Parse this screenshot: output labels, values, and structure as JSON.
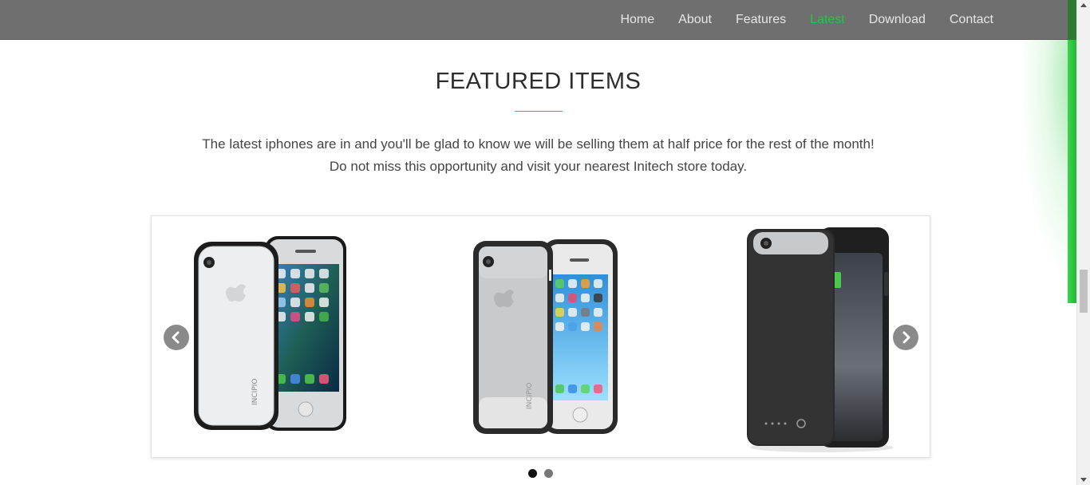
{
  "nav": {
    "items": [
      {
        "label": "Home",
        "active": false
      },
      {
        "label": "About",
        "active": false
      },
      {
        "label": "Features",
        "active": false
      },
      {
        "label": "Latest",
        "active": true
      },
      {
        "label": "Download",
        "active": false
      },
      {
        "label": "Contact",
        "active": false
      }
    ],
    "active_color": "#27c34a",
    "background": "#6f6f6f"
  },
  "section": {
    "title": "FEATURED ITEMS",
    "intro_line1": "The latest iphones are in and you'll be glad to know we will be selling them at half price for the rest of the month!",
    "intro_line2": "Do not miss this opportunity and visit your nearest Initech store today."
  },
  "carousel": {
    "products": [
      {
        "name": "clear-bumper-phone-case"
      },
      {
        "name": "grey-frosted-phone-case"
      },
      {
        "name": "black-battery-phone-case"
      }
    ],
    "prev_icon": "chevron-left-icon",
    "next_icon": "chevron-right-icon",
    "slides": 2,
    "active_slide": 1
  },
  "colors": {
    "accent": "#27c34a",
    "text": "#2d2d2d"
  }
}
